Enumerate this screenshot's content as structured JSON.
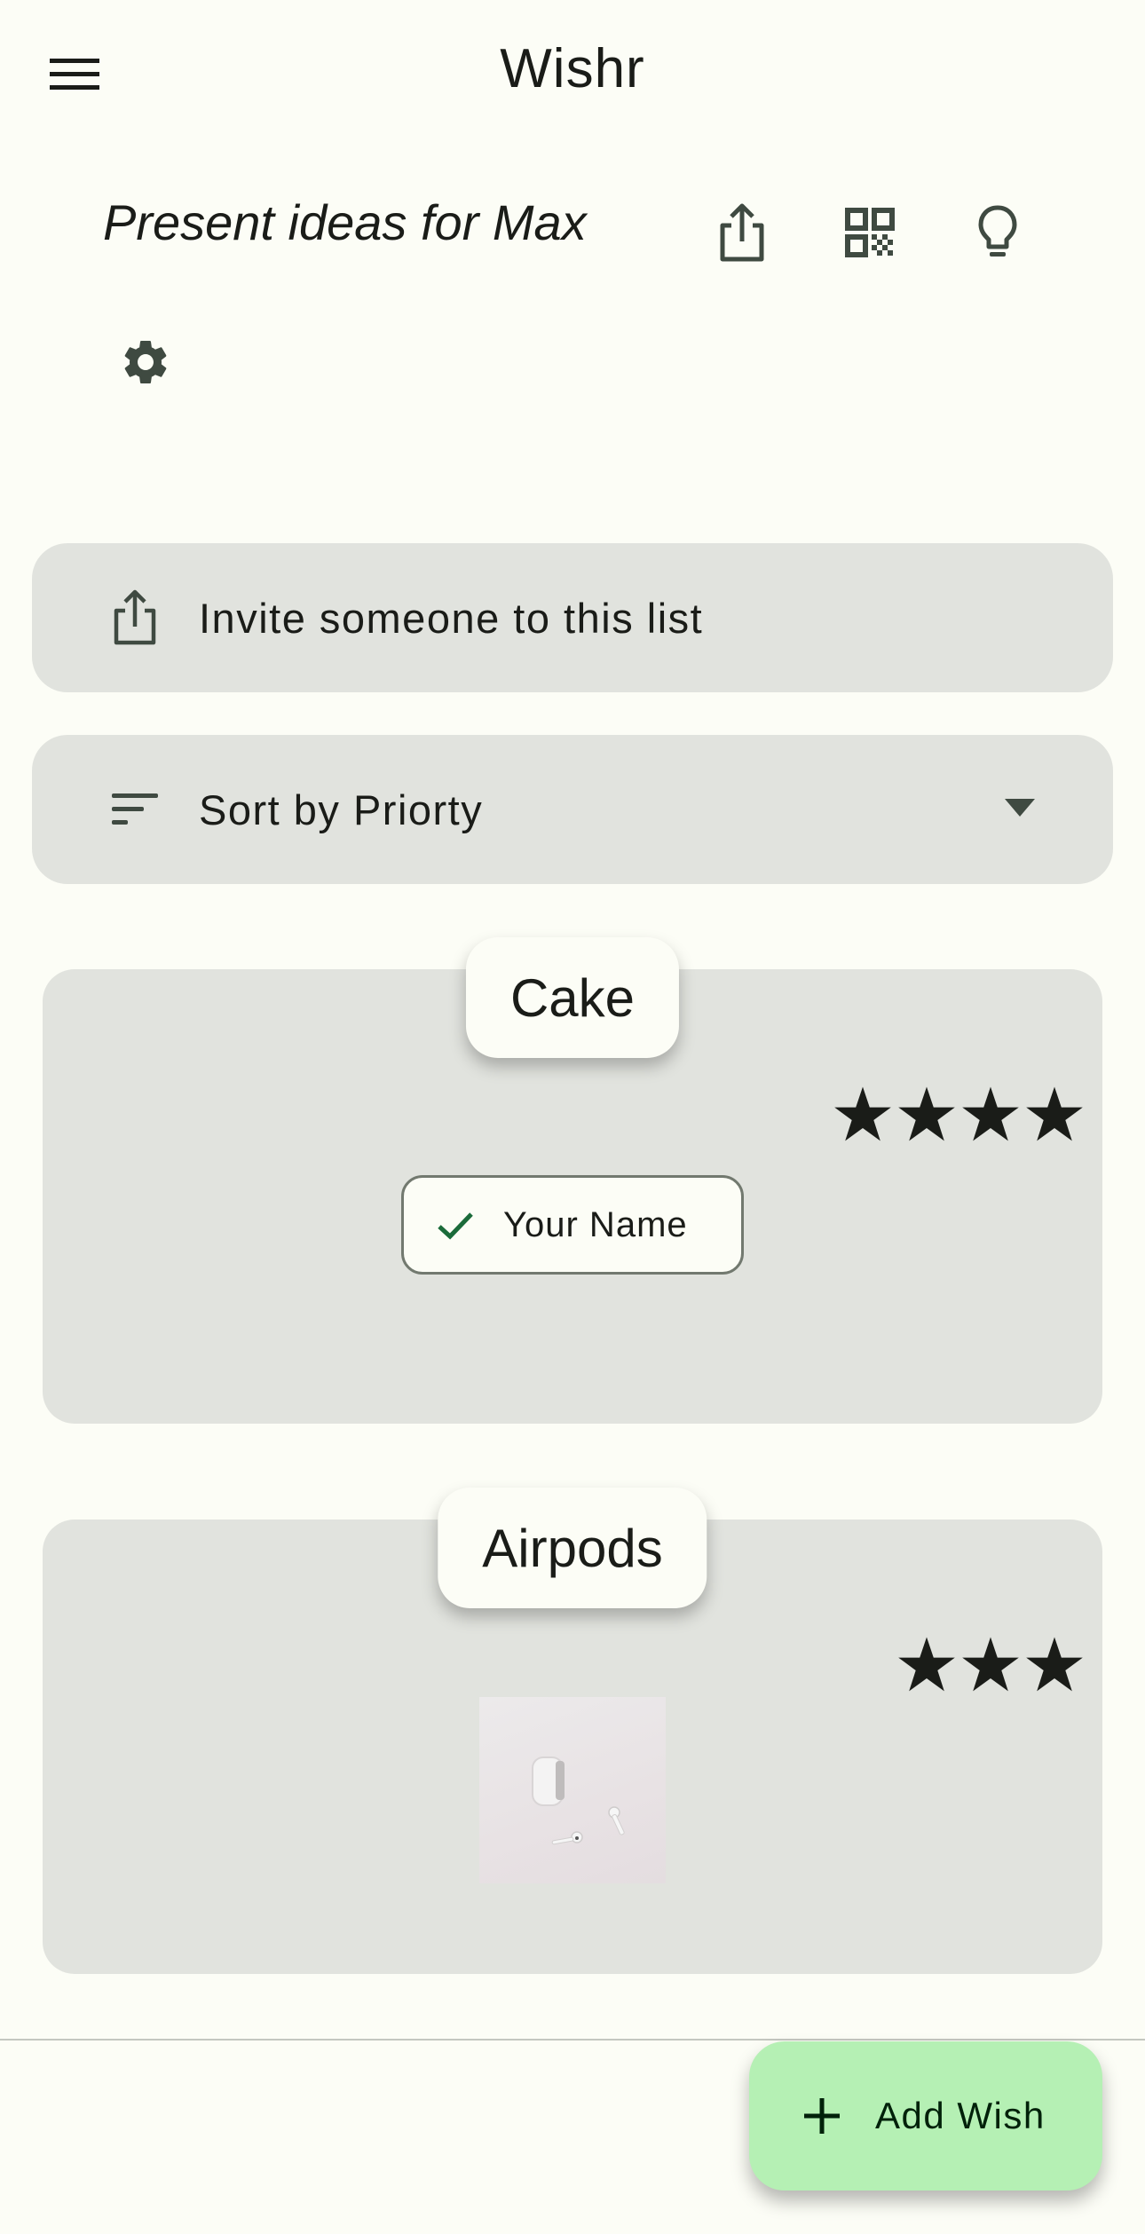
{
  "app_bar": {
    "title": "Wishr",
    "menu_icon": "menu-icon"
  },
  "list_header": {
    "title": "Present ideas for Max",
    "actions": [
      {
        "name": "share",
        "icon": "share-icon"
      },
      {
        "name": "qr-code",
        "icon": "qr-code-icon"
      },
      {
        "name": "ideas",
        "icon": "lightbulb-icon"
      },
      {
        "name": "settings",
        "icon": "gear-icon"
      }
    ]
  },
  "invite": {
    "label": "Invite someone to this list",
    "icon": "share-icon"
  },
  "sort": {
    "label": "Sort by Priorty",
    "icon": "sort-icon",
    "dropdown_icon": "arrow-drop-down-icon"
  },
  "wishes": [
    {
      "title": "Cake",
      "priority": 4,
      "claimed_by": "Your Name",
      "claimed": true
    },
    {
      "title": "Airpods",
      "priority": 3,
      "has_image": true
    }
  ],
  "fab": {
    "label": "Add Wish",
    "icon": "plus-icon"
  },
  "colors": {
    "background": "#fcfdf6",
    "surface_variant": "#e1e3de",
    "fab": "#b5f0b4",
    "check": "#1b6b3a",
    "icon": "#3f4a41"
  }
}
